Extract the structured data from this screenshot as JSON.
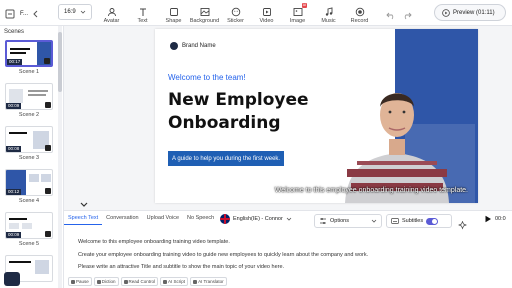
{
  "toolbar": {
    "project_short": "F...",
    "aspect_ratio": "16:9",
    "tools": [
      {
        "label": "Avatar",
        "icon": "avatar-icon"
      },
      {
        "label": "Text",
        "icon": "text-icon"
      },
      {
        "label": "Shape",
        "icon": "shape-icon"
      },
      {
        "label": "Background",
        "icon": "background-icon"
      },
      {
        "label": "Sticker",
        "icon": "sticker-icon"
      },
      {
        "label": "Video",
        "icon": "video-icon"
      },
      {
        "label": "Image",
        "icon": "image-icon"
      },
      {
        "label": "Music",
        "icon": "music-icon"
      },
      {
        "label": "Record",
        "icon": "record-icon"
      }
    ],
    "image_badge": "AI",
    "preview_label": "Preview (01:11)"
  },
  "sidebar": {
    "title": "Scenes",
    "scenes": [
      {
        "label": "Scene 1",
        "time": "00:17",
        "active": true
      },
      {
        "label": "Scene 2",
        "time": "00:09",
        "active": false
      },
      {
        "label": "Scene 3",
        "time": "00:08",
        "active": false
      },
      {
        "label": "Scene 4",
        "time": "00:12",
        "active": false
      },
      {
        "label": "Scene 5",
        "time": "00:09",
        "active": false
      }
    ]
  },
  "slide": {
    "brand_name": "Brand Name",
    "welcome": "Welcome to the team!",
    "title_line1": "New Employee",
    "title_line2": "Onboarding",
    "subtitle": "A guide to help you during the first week.",
    "caption": "Welcome to this employee onboarding training video template.",
    "colors": {
      "accent": "#2563eb",
      "panel": "#2f56a8",
      "subtitle_bg": "#1f5fb4"
    }
  },
  "bottom": {
    "tabs": [
      "Speech Text",
      "Conversation",
      "Upload Voice",
      "No Speech"
    ],
    "voice": "English(IE) - Connor",
    "options_label": "Options",
    "subtitles_label": "Subtitles",
    "time": "00:0",
    "script_lines": [
      "Welcome to this employee onboarding training video template.",
      "Create your employee onboarding training video to guide new employees to quickly learn about the company and work.",
      "Please write an attractive Title and subtitle to show the main topic of your video here."
    ],
    "actions": [
      "Pause",
      "Diction",
      "Read Control",
      "AI Script",
      "AI Translator"
    ]
  }
}
